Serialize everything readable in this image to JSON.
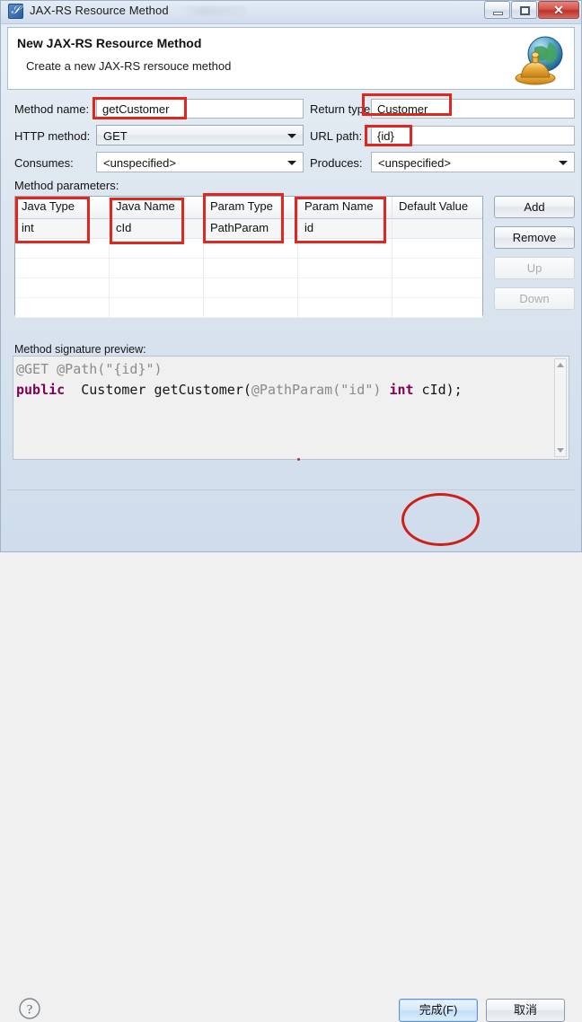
{
  "window": {
    "title": "JAX-RS Resource Method",
    "icon": "jaxrs-icon",
    "controls": {
      "minimize": "minimize-icon",
      "maximize": "maximize-icon",
      "close": "✕"
    }
  },
  "header": {
    "title": "New JAX-RS Resource Method",
    "subtitle": "Create a new JAX-RS rersouce method",
    "artwork": "globe-bell-icon"
  },
  "form": {
    "method_name": {
      "label": "Method name:",
      "value": "getCustomer"
    },
    "return_type": {
      "label": "Return type",
      "value": "Customer"
    },
    "http_method": {
      "label": "HTTP method:",
      "value": "GET"
    },
    "url_path": {
      "label": "URL path:",
      "value": "{id}"
    },
    "consumes": {
      "label": "Consumes:",
      "value": "<unspecified>"
    },
    "produces": {
      "label": "Produces:",
      "value": "<unspecified>"
    }
  },
  "parameters": {
    "label": "Method parameters:",
    "columns": [
      "Java Type",
      "Java Name",
      "Param Type",
      "Param Name",
      "Default Value"
    ],
    "rows": [
      [
        "int",
        "cId",
        "PathParam",
        "id",
        ""
      ]
    ],
    "empty_row_count": 4,
    "buttons": [
      {
        "label": "Add",
        "enabled": true
      },
      {
        "label": "Remove",
        "enabled": true
      },
      {
        "label": "Up",
        "enabled": false
      },
      {
        "label": "Down",
        "enabled": false
      }
    ]
  },
  "preview": {
    "label": "Method signature preview:",
    "line1_annotation": "@GET @Path(\"{id}\")",
    "line2": {
      "keyword1": "public",
      "spacer1": "  ",
      "return_type": "Customer getCustomer(",
      "annotation": "@PathParam(\"id\")",
      "keyword2": "int",
      "tail": " cId);"
    }
  },
  "footer": {
    "help": "help-icon",
    "finish": "完成(F)",
    "cancel": "取消"
  },
  "colors": {
    "annotation_red": "#e0261d",
    "keyword_purple": "#7f0055",
    "default_button_blue": "#c3dff6"
  }
}
